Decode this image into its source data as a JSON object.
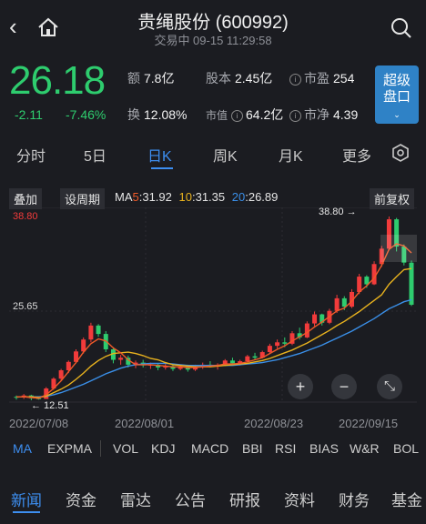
{
  "header": {
    "back": "‹",
    "title": "贵绳股份 (600992)",
    "subtitle": "交易中 09-15 11:29:58"
  },
  "quote": {
    "price": "26.18",
    "change": "-2.11",
    "change_pct": "-7.46%",
    "turnover_k": "额",
    "turnover_v": "7.8亿",
    "share_k": "股本",
    "share_v": "2.45亿",
    "pe_k": "市盈",
    "pe_v": "254",
    "rate_k": "换",
    "rate_v": "12.08%",
    "mcap_k": "市值",
    "mcap_v": "64.2亿",
    "pb_k": "市净",
    "pb_v": "4.39",
    "info_icon": "ⓘ",
    "super_l1": "超级",
    "super_l2": "盘口",
    "super_chev": "⌄"
  },
  "tabs": [
    "分时",
    "5日",
    "日K",
    "周K",
    "月K",
    "更多"
  ],
  "toolbar": {
    "overlay": "叠加",
    "period": "设周期",
    "ma_label": "MA",
    "ma5_k": "5",
    "ma5_v": ":31.92",
    "ma10_k": "10",
    "ma10_v": ":31.35",
    "ma20_k": "20",
    "ma20_v": ":26.89",
    "adjust": "前复权"
  },
  "chart_data": {
    "type": "candlestick",
    "high_label": "38.80",
    "high_arrow_label": "38.80 →",
    "mid_label": "25.65",
    "low_label": "← 12.51",
    "y_range": [
      12.51,
      38.8
    ],
    "dates": [
      "2022/07/08",
      "2022/08/01",
      "2022/08/23",
      "2022/09/15"
    ],
    "candles": [
      [
        13.0,
        13.2,
        12.6,
        12.9
      ],
      [
        12.9,
        13.4,
        12.7,
        13.2
      ],
      [
        13.2,
        13.3,
        12.51,
        12.8
      ],
      [
        12.8,
        13.0,
        12.6,
        12.7
      ],
      [
        12.7,
        14.4,
        12.7,
        14.2
      ],
      [
        14.2,
        15.8,
        14.0,
        15.6
      ],
      [
        15.6,
        17.0,
        15.3,
        16.8
      ],
      [
        16.8,
        18.2,
        16.4,
        18.0
      ],
      [
        18.0,
        19.8,
        17.8,
        19.5
      ],
      [
        19.5,
        21.5,
        19.2,
        21.2
      ],
      [
        21.2,
        23.6,
        20.8,
        23.2
      ],
      [
        23.2,
        23.4,
        21.6,
        22.0
      ],
      [
        22.0,
        22.4,
        19.4,
        19.8
      ],
      [
        19.8,
        20.1,
        17.8,
        18.3
      ],
      [
        18.3,
        19.0,
        17.6,
        18.6
      ],
      [
        18.6,
        18.9,
        17.2,
        17.6
      ],
      [
        17.6,
        18.2,
        17.1,
        17.9
      ],
      [
        17.9,
        18.3,
        17.2,
        17.5
      ],
      [
        17.5,
        17.9,
        17.0,
        17.6
      ],
      [
        17.6,
        17.8,
        16.8,
        17.2
      ],
      [
        17.2,
        17.7,
        16.9,
        17.4
      ],
      [
        17.4,
        17.6,
        16.7,
        17.0
      ],
      [
        17.0,
        17.5,
        16.8,
        17.3
      ],
      [
        17.3,
        17.6,
        16.6,
        16.9
      ],
      [
        16.9,
        17.6,
        16.7,
        17.4
      ],
      [
        17.4,
        17.9,
        17.0,
        17.6
      ],
      [
        17.6,
        18.1,
        17.2,
        17.4
      ],
      [
        17.4,
        17.8,
        16.9,
        17.6
      ],
      [
        17.6,
        18.4,
        17.4,
        18.2
      ],
      [
        18.2,
        18.6,
        17.6,
        17.8
      ],
      [
        17.8,
        18.3,
        17.5,
        18.1
      ],
      [
        18.1,
        19.0,
        17.9,
        18.8
      ],
      [
        18.8,
        19.3,
        18.3,
        18.6
      ],
      [
        18.6,
        19.6,
        18.5,
        19.4
      ],
      [
        19.4,
        20.6,
        19.2,
        20.3
      ],
      [
        20.3,
        21.2,
        19.9,
        20.8
      ],
      [
        20.8,
        21.5,
        20.1,
        20.6
      ],
      [
        20.6,
        22.4,
        20.4,
        22.1
      ],
      [
        22.1,
        22.9,
        21.2,
        21.5
      ],
      [
        21.5,
        23.8,
        21.4,
        23.5
      ],
      [
        23.5,
        25.2,
        23.1,
        24.8
      ],
      [
        24.8,
        24.9,
        23.2,
        23.6
      ],
      [
        23.6,
        25.6,
        23.4,
        25.3
      ],
      [
        25.3,
        27.6,
        25.0,
        27.1
      ],
      [
        27.1,
        27.4,
        25.4,
        25.9
      ],
      [
        25.9,
        28.4,
        25.7,
        28.0
      ],
      [
        28.0,
        30.6,
        27.7,
        30.2
      ],
      [
        30.2,
        30.4,
        28.6,
        29.1
      ],
      [
        29.1,
        32.4,
        29.0,
        32.0
      ],
      [
        32.0,
        34.6,
        31.6,
        34.2
      ],
      [
        34.2,
        38.8,
        34.0,
        38.4
      ],
      [
        38.4,
        38.6,
        33.8,
        34.5
      ],
      [
        34.5,
        34.8,
        31.8,
        32.2
      ],
      [
        32.2,
        32.5,
        26.0,
        26.18
      ]
    ],
    "ma5": [
      13.0,
      13.0,
      12.9,
      12.8,
      13.3,
      14.2,
      15.3,
      16.6,
      17.9,
      19.4,
      20.6,
      21.3,
      21.0,
      20.0,
      19.3,
      18.3,
      17.6,
      17.6,
      17.6,
      17.5,
      17.4,
      17.3,
      17.3,
      17.2,
      17.2,
      17.3,
      17.4,
      17.5,
      17.7,
      17.7,
      17.8,
      18.0,
      18.3,
      18.6,
      19.2,
      19.8,
      20.3,
      21.0,
      21.6,
      22.2,
      23.0,
      23.7,
      24.5,
      25.3,
      25.7,
      26.7,
      28.0,
      28.9,
      30.0,
      31.8,
      34.1,
      34.9,
      34.6,
      33.6
    ],
    "ma10": [
      13.0,
      13.0,
      13.0,
      12.9,
      13.1,
      13.6,
      14.1,
      14.7,
      15.5,
      16.4,
      17.4,
      18.2,
      18.8,
      19.2,
      19.3,
      19.4,
      19.2,
      18.9,
      18.5,
      18.3,
      17.9,
      17.6,
      17.5,
      17.4,
      17.3,
      17.3,
      17.3,
      17.4,
      17.5,
      17.6,
      17.7,
      17.8,
      18.0,
      18.2,
      18.5,
      18.9,
      19.3,
      19.7,
      20.2,
      20.7,
      21.3,
      21.9,
      22.5,
      23.2,
      23.8,
      24.5,
      25.2,
      26.0,
      26.8,
      27.6,
      29.1,
      30.2,
      31.2,
      31.35
    ],
    "ma20": [
      13.0,
      13.0,
      13.0,
      13.0,
      13.1,
      13.3,
      13.6,
      14.0,
      14.4,
      14.8,
      15.3,
      15.8,
      16.3,
      16.7,
      17.1,
      17.4,
      17.6,
      17.7,
      17.8,
      17.8,
      17.8,
      17.7,
      17.6,
      17.5,
      17.5,
      17.5,
      17.5,
      17.5,
      17.5,
      17.5,
      17.6,
      17.7,
      17.8,
      17.9,
      18.1,
      18.3,
      18.6,
      18.9,
      19.2,
      19.6,
      20.0,
      20.4,
      20.9,
      21.4,
      21.9,
      22.4,
      23.0,
      23.6,
      24.2,
      24.9,
      25.6,
      26.1,
      26.6,
      26.89
    ]
  },
  "chart_controls": {
    "zoom_in": "+",
    "zoom_out": "−",
    "fullscreen": "⤡"
  },
  "indicators": [
    "MA",
    "EXPMA",
    "VOL",
    "KDJ",
    "MACD",
    "BBI",
    "RSI",
    "BIAS",
    "W&R",
    "BOL"
  ],
  "bottom_tabs": [
    "新闻",
    "资金",
    "雷达",
    "公告",
    "研报",
    "资料",
    "财务",
    "基金"
  ],
  "colors": {
    "up": "#f23b3b",
    "down": "#2ecc6e",
    "ma5": "#f05a28",
    "ma10": "#e8b21e",
    "ma20": "#3a8fe8",
    "accent": "#3d8ef0"
  }
}
